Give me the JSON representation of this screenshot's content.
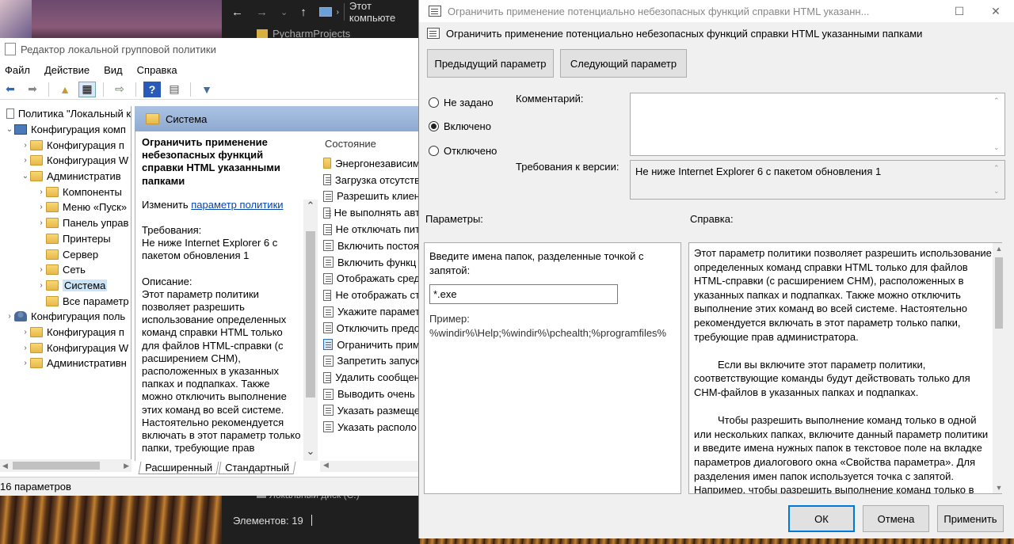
{
  "explorer": {
    "title": "Этот компьюте",
    "partial_folder": "PycharmProjects",
    "disk": "Локальный диск (C:)",
    "status": "Элементов: 19"
  },
  "gpedit": {
    "title": "Редактор локальной групповой политики",
    "menu": [
      "Файл",
      "Действие",
      "Вид",
      "Справка"
    ],
    "tree": [
      {
        "label": "Политика \"Локальный к",
        "level": 0,
        "arrow": "",
        "icon": "doc"
      },
      {
        "label": "Конфигурация комп",
        "level": 1,
        "arrow": "⌄",
        "icon": "pc"
      },
      {
        "label": "Конфигурация п",
        "level": 2,
        "arrow": "›",
        "icon": "folder"
      },
      {
        "label": "Конфигурация W",
        "level": 2,
        "arrow": "›",
        "icon": "folder"
      },
      {
        "label": "Административ",
        "level": 2,
        "arrow": "⌄",
        "icon": "folder"
      },
      {
        "label": "Компоненты",
        "level": 3,
        "arrow": "›",
        "icon": "folder"
      },
      {
        "label": "Меню «Пуск»",
        "level": 3,
        "arrow": "›",
        "icon": "folder"
      },
      {
        "label": "Панель управ",
        "level": 3,
        "arrow": "›",
        "icon": "folder"
      },
      {
        "label": "Принтеры",
        "level": 3,
        "arrow": "",
        "icon": "folder"
      },
      {
        "label": "Сервер",
        "level": 3,
        "arrow": "",
        "icon": "folder"
      },
      {
        "label": "Сеть",
        "level": 3,
        "arrow": "›",
        "icon": "folder"
      },
      {
        "label": "Система",
        "level": 3,
        "arrow": "›",
        "icon": "folder",
        "selected": true
      },
      {
        "label": "Все параметр",
        "level": 3,
        "arrow": "",
        "icon": "folder"
      },
      {
        "label": "Конфигурация поль",
        "level": 1,
        "arrow": "›",
        "icon": "user"
      },
      {
        "label": "Конфигурация п",
        "level": 2,
        "arrow": "›",
        "icon": "folder"
      },
      {
        "label": "Конфигурация W",
        "level": 2,
        "arrow": "›",
        "icon": "folder"
      },
      {
        "label": "Административн",
        "level": 2,
        "arrow": "›",
        "icon": "folder"
      }
    ],
    "section_title": "Система",
    "desc": {
      "title": "Ограничить применение небезопасных функций справки HTML указанными папками",
      "edit_prefix": "Изменить ",
      "edit_link": "параметр политики",
      "req_label": "Требования:",
      "req_text": "Не ниже Internet Explorer 6 с пакетом обновления 1",
      "desc_label": "Описание:",
      "desc_text": "Этот параметр политики позволяет разрешить использование определенных команд справки HTML только для файлов HTML-справки (с расширением CHM), расположенных в указанных папках и подпапках. Также можно отключить выполнение этих команд во всей системе. Настоятельно рекомендуется включать в этот параметр только папки, требующие прав"
    },
    "list_header": "Состояние",
    "list": [
      {
        "label": "Энергонезависим",
        "icon": "folder"
      },
      {
        "label": "Загрузка отсутств",
        "icon": "setting"
      },
      {
        "label": "Разрешить клиен",
        "icon": "setting"
      },
      {
        "label": "Не выполнять авт",
        "icon": "setting"
      },
      {
        "label": "Не отключать пит",
        "icon": "setting"
      },
      {
        "label": "Включить постоя",
        "icon": "setting"
      },
      {
        "label": "Включить функц",
        "icon": "setting"
      },
      {
        "label": "Отображать сред",
        "icon": "setting"
      },
      {
        "label": "Не отображать ст",
        "icon": "setting"
      },
      {
        "label": "Укажите парамет",
        "icon": "setting"
      },
      {
        "label": "Отключить предо",
        "icon": "setting"
      },
      {
        "label": "Ограничить прим",
        "icon": "setting",
        "selected": true
      },
      {
        "label": "Запретить запуск",
        "icon": "setting"
      },
      {
        "label": "Удалить сообщен",
        "icon": "setting"
      },
      {
        "label": "Выводить очень",
        "icon": "setting"
      },
      {
        "label": "Указать размеще",
        "icon": "setting"
      },
      {
        "label": "Указать располо",
        "icon": "setting"
      }
    ],
    "tabs": [
      "Расширенный",
      "Стандартный"
    ],
    "status": "16 параметров"
  },
  "dialog": {
    "title": "Ограничить применение потенциально небезопасных функций справки HTML указанн...",
    "header": "Ограничить применение потенциально небезопасных функций справки HTML указанными папками",
    "prev_btn": "Предыдущий параметр",
    "next_btn": "Следующий параметр",
    "radios": [
      {
        "label": "Не задано",
        "checked": false
      },
      {
        "label": "Включено",
        "checked": true
      },
      {
        "label": "Отключено",
        "checked": false
      }
    ],
    "comment_label": "Комментарий:",
    "comment_value": "",
    "req_label": "Требования к версии:",
    "req_value": "Не ниже Internet Explorer 6 с пакетом обновления 1",
    "params_label": "Параметры:",
    "help_label": "Справка:",
    "param_prompt": "Введите имена папок, разделенные точкой с запятой:",
    "param_value": "*.exe",
    "param_example": "Пример: %windir%\\Help;%windir%\\pchealth;%programfiles%",
    "help_p1": "Этот параметр политики позволяет разрешить использование определенных команд справки HTML только для файлов HTML-справки (с расширением CHM), расположенных в указанных папках и подпапках. Также можно отключить выполнение этих команд во всей системе. Настоятельно рекомендуется включать в этот параметр только папки, требующие прав администратора.",
    "help_p2": "Если вы включите этот параметр политики, соответствующие команды будут действовать только для CHM-файлов в указанных папках и подпапках.",
    "help_p3": "Чтобы разрешить выполнение команд только в одной или нескольких папках, включите данный параметр политики и введите имена нужных папок в текстовое поле на вкладке параметров диалогового окна «Свойства параметра». Для разделения имен папок используется точка с запятой. Например, чтобы разрешить выполнение команд только в",
    "ok": "ОК",
    "cancel": "Отмена",
    "apply": "Применить"
  }
}
